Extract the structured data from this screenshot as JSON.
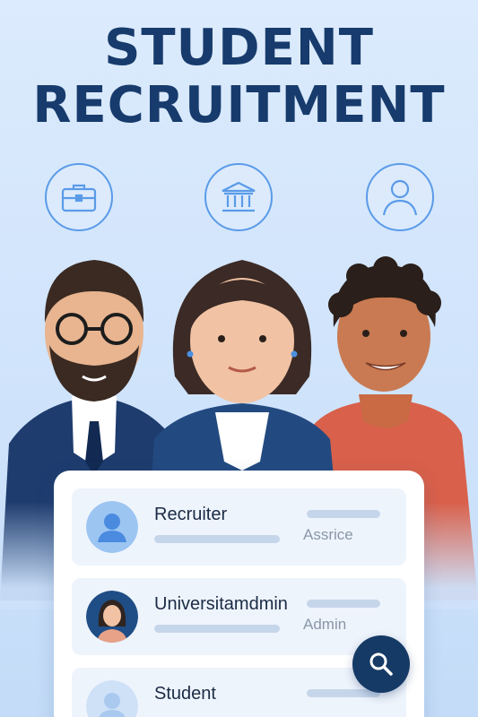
{
  "title": {
    "line1": "STUDENT",
    "line2": "RECRUITMENT"
  },
  "top_icons": [
    "briefcase-icon",
    "university-icon",
    "user-profile-icon"
  ],
  "users": [
    {
      "name": "Recruiter",
      "role": "Assrice",
      "avatar": "generic-user-avatar"
    },
    {
      "name": "Universitamdmin",
      "role": "Admin",
      "avatar": "woman-avatar"
    },
    {
      "name": "Student",
      "role": "",
      "avatar": "generic-user-avatar"
    }
  ],
  "search_button": {
    "icon": "search-icon"
  },
  "colors": {
    "title": "#173b6c",
    "accent": "#5a9be8",
    "search_button": "#163a66"
  }
}
